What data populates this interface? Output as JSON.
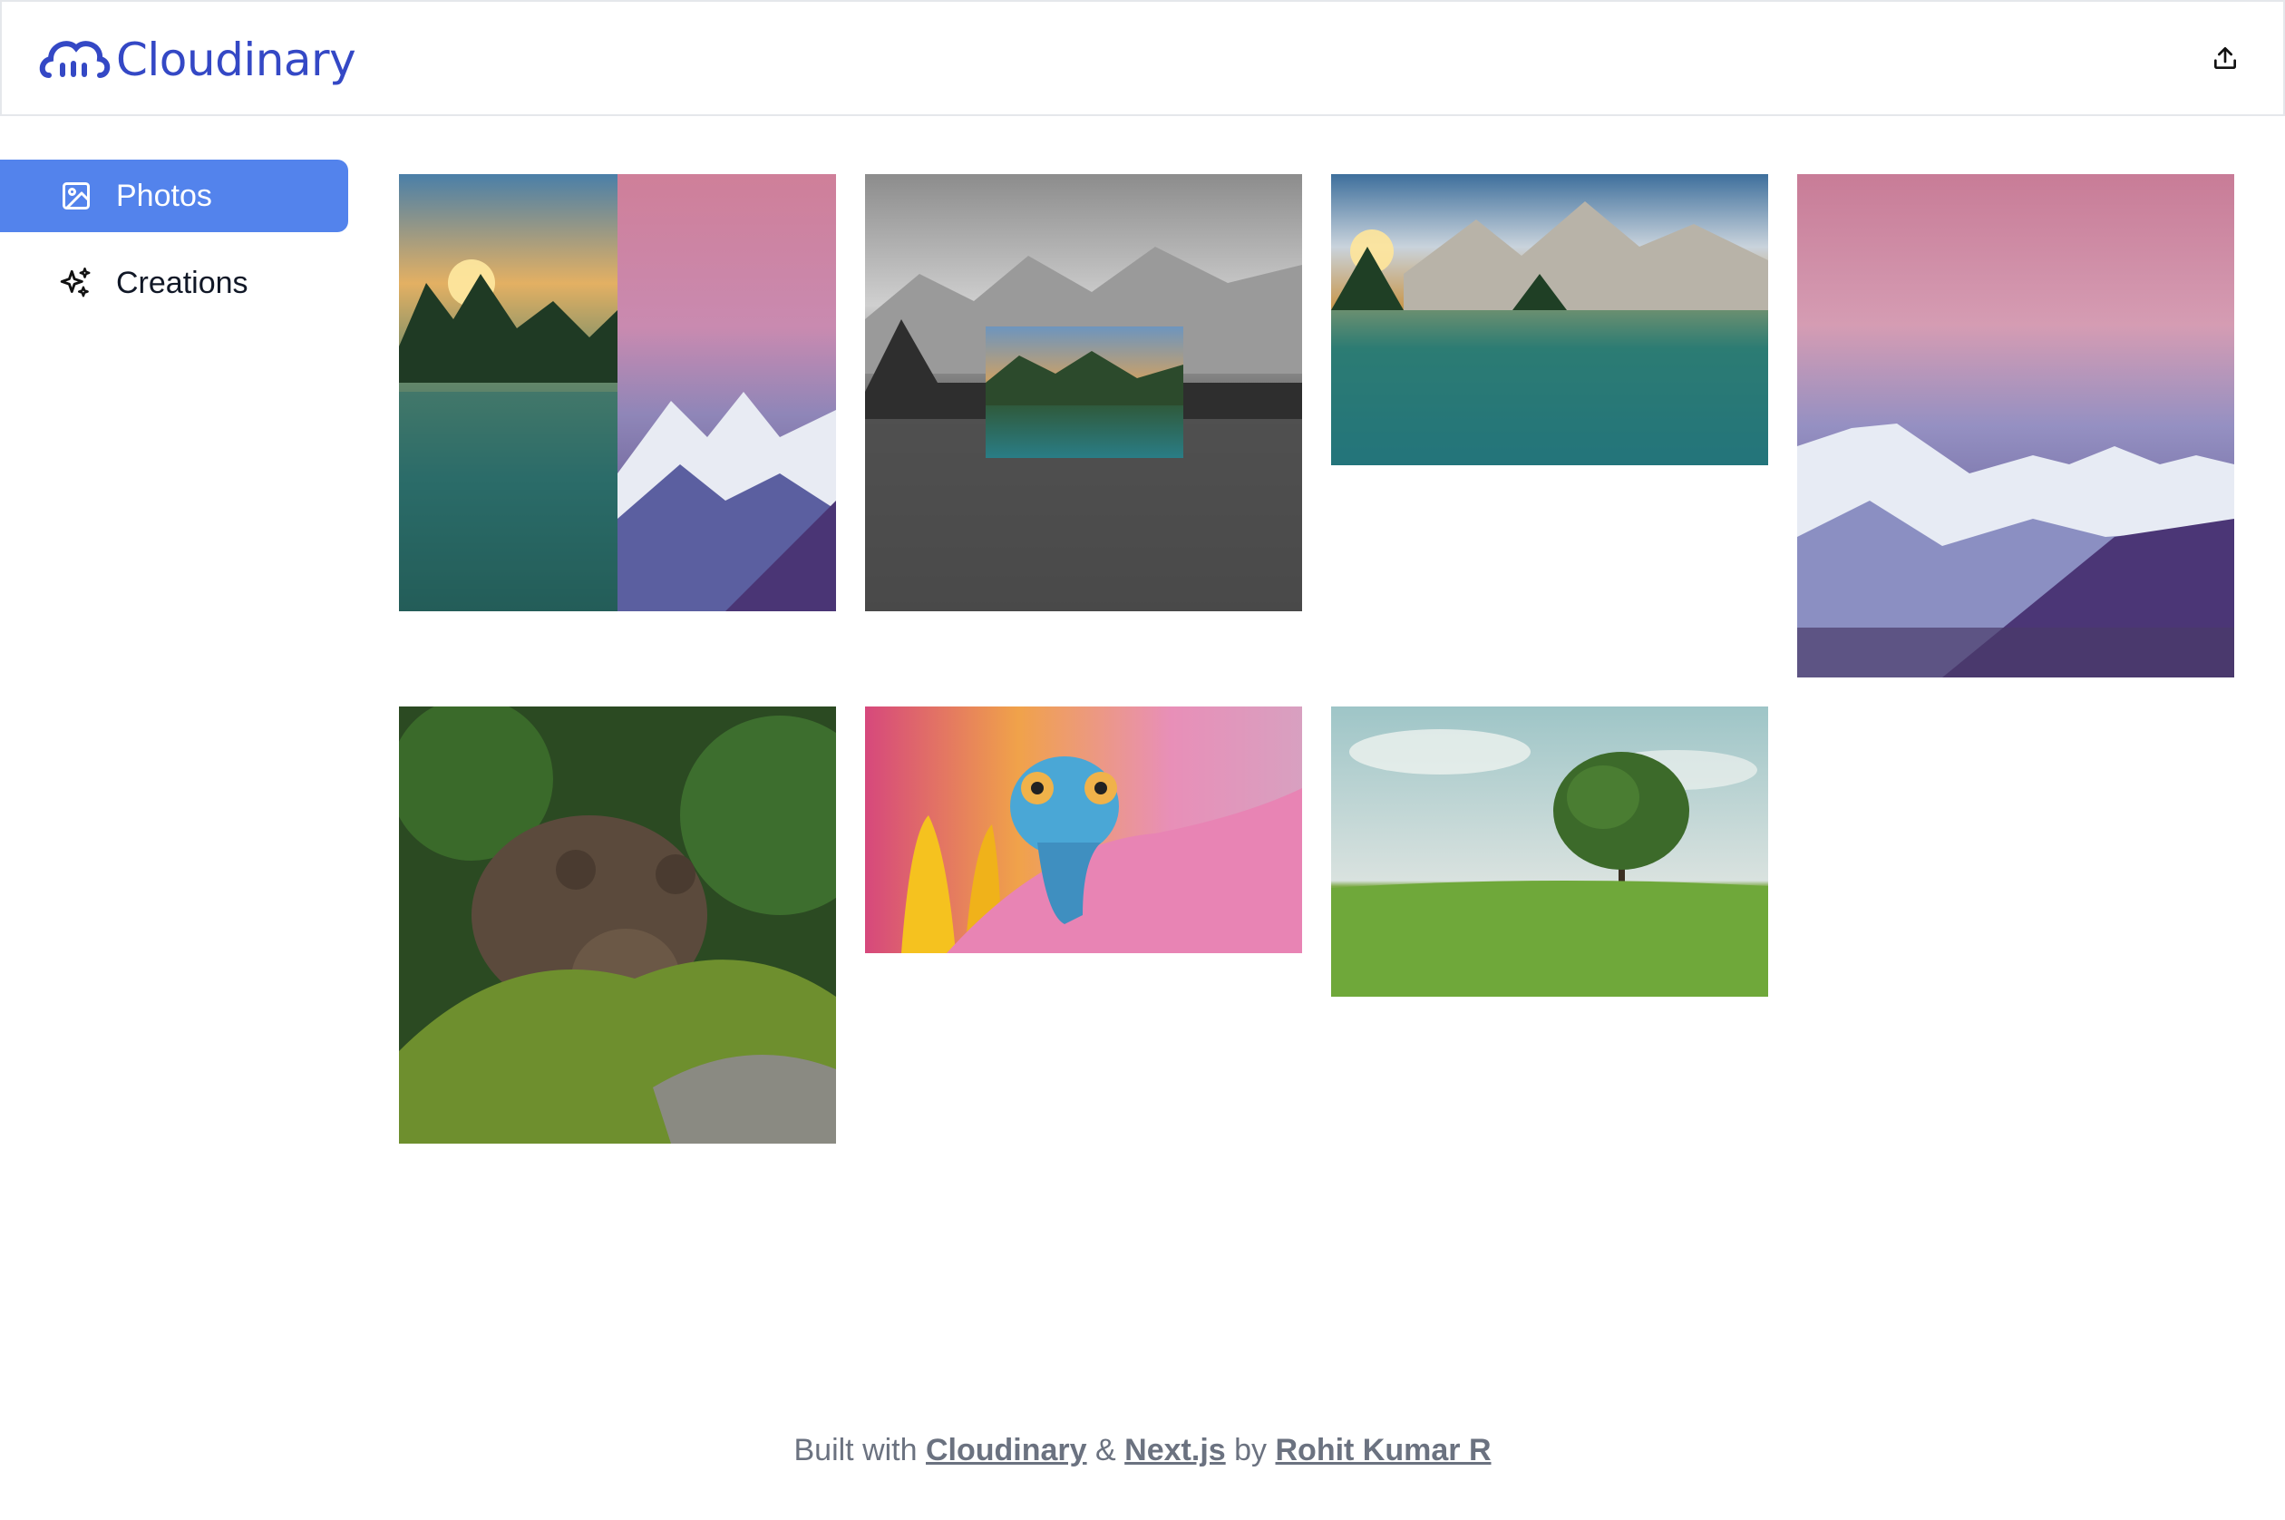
{
  "header": {
    "logo_text": "Cloudinary",
    "brand_color": "#3448c5",
    "upload_icon": "upload-icon"
  },
  "sidebar": {
    "active_color": "#5383ec",
    "items": [
      {
        "label": "Photos",
        "icon": "image-icon",
        "active": true
      },
      {
        "label": "Creations",
        "icon": "sparkles-icon",
        "active": false
      }
    ]
  },
  "gallery": {
    "photos": [
      {
        "subject": "lake sunrise and pink sky mountains split"
      },
      {
        "subject": "grayscale mountain lake with color inset"
      },
      {
        "subject": "mountain lake sunrise"
      },
      {
        "subject": "snowy mountains pink sky"
      },
      {
        "subject": "brown bear on mossy rock"
      },
      {
        "subject": "blue chameleon on pink flower"
      },
      {
        "subject": "lone tree on green meadow"
      }
    ]
  },
  "footer": {
    "prefix": "Built with",
    "link1": "Cloudinary",
    "amp": "&",
    "link2": "Next.js",
    "by": "by",
    "author": "Rohit Kumar R"
  }
}
